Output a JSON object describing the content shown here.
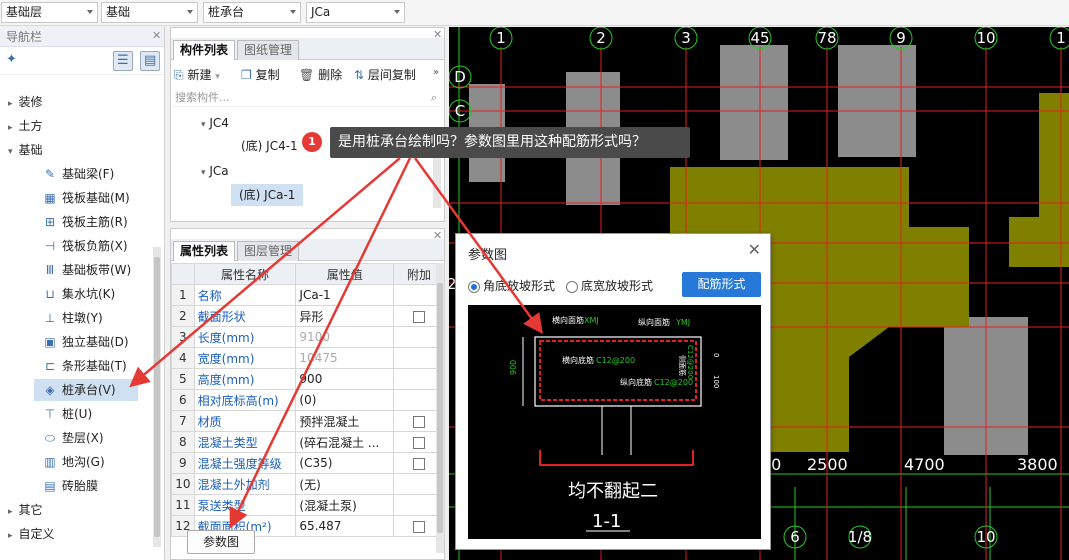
{
  "topbar": {
    "floor": "基础层",
    "category": "基础",
    "type": "桩承台",
    "instance": "JCa"
  },
  "nav": {
    "title": "导航栏",
    "groups": [
      {
        "label": "装修",
        "expanded": false
      },
      {
        "label": "土方",
        "expanded": false
      },
      {
        "label": "基础",
        "expanded": true
      }
    ],
    "items": [
      {
        "label": "基础梁(F)",
        "icon": "beam-icon",
        "glyph": "✎"
      },
      {
        "label": "筏板基础(M)",
        "icon": "grid-icon",
        "glyph": "▦"
      },
      {
        "label": "筏板主筋(R)",
        "icon": "rebar-grid-icon",
        "glyph": "⊞"
      },
      {
        "label": "筏板负筋(X)",
        "icon": "neg-rebar-icon",
        "glyph": "⊣"
      },
      {
        "label": "基础板带(W)",
        "icon": "strip-icon",
        "glyph": "Ⅲ"
      },
      {
        "label": "集水坑(K)",
        "icon": "pit-icon",
        "glyph": "⊔"
      },
      {
        "label": "柱墩(Y)",
        "icon": "pier-icon",
        "glyph": "⊥"
      },
      {
        "label": "独立基础(D)",
        "icon": "isolated-footing-icon",
        "glyph": "▣"
      },
      {
        "label": "条形基础(T)",
        "icon": "strip-footing-icon",
        "glyph": "⊏"
      },
      {
        "label": "桩承台(V)",
        "icon": "pile-cap-icon",
        "glyph": "◈"
      },
      {
        "label": "桩(U)",
        "icon": "pile-icon",
        "glyph": "⊤"
      },
      {
        "label": "垫层(X)",
        "icon": "cushion-icon",
        "glyph": "⬭"
      },
      {
        "label": "地沟(G)",
        "icon": "trench-icon",
        "glyph": "▥"
      },
      {
        "label": "砖胎膜",
        "icon": "brick-icon",
        "glyph": "▤"
      }
    ],
    "groups_after": [
      {
        "label": "其它"
      },
      {
        "label": "自定义"
      }
    ]
  },
  "component_panel": {
    "tabs": [
      "构件列表",
      "图纸管理"
    ],
    "toolbar": {
      "new": "新建",
      "copy": "复制",
      "delete": "删除",
      "floor_copy": "层间复制"
    },
    "search_placeholder": "搜索构件...",
    "tree": [
      {
        "label": "JC4",
        "children": [
          "(底) JC4-1"
        ]
      },
      {
        "label": "JCa",
        "children": [
          "(底) JCa-1"
        ]
      }
    ]
  },
  "property_panel": {
    "tabs": [
      "属性列表",
      "图层管理"
    ],
    "headers": [
      "属性名称",
      "属性值",
      "附加"
    ],
    "rows": [
      {
        "n": "1",
        "name": "名称",
        "value": "JCa-1",
        "check": false
      },
      {
        "n": "2",
        "name": "截面形状",
        "value": "异形",
        "check": true
      },
      {
        "n": "3",
        "name": "长度(mm)",
        "value": "9100",
        "check": false
      },
      {
        "n": "4",
        "name": "宽度(mm)",
        "value": "10475",
        "check": false
      },
      {
        "n": "5",
        "name": "高度(mm)",
        "value": "900",
        "check": false
      },
      {
        "n": "6",
        "name": "相对底标高(m)",
        "value": "(0)",
        "check": false
      },
      {
        "n": "7",
        "name": "材质",
        "value": "预拌混凝土",
        "check": true
      },
      {
        "n": "8",
        "name": "混凝土类型",
        "value": "(碎石混凝土 ...",
        "check": true
      },
      {
        "n": "9",
        "name": "混凝土强度等级",
        "value": "(C35)",
        "check": true
      },
      {
        "n": "10",
        "name": "混凝土外加剂",
        "value": "(无)",
        "check": false
      },
      {
        "n": "11",
        "name": "泵送类型",
        "value": "(混凝土泵)",
        "check": false
      },
      {
        "n": "12",
        "name": "截面面积(m²)",
        "value": "65.487",
        "check": true
      }
    ],
    "bottom_button": "参数图"
  },
  "tooltip": {
    "badge": "1",
    "text": "是用桩承台绘制吗？参数图里用这种配筋形式吗？"
  },
  "cad": {
    "top_axis": [
      "1",
      "2",
      "3",
      "45",
      "78",
      "9",
      "10",
      "1"
    ],
    "left_axis": [
      "D",
      "C"
    ],
    "left_label": "2",
    "dims": [
      "00",
      "2500",
      "4700",
      "3800"
    ],
    "bottom_axis": [
      "6",
      "1/8",
      "10"
    ]
  },
  "dialog": {
    "title": "参数图",
    "radio1": "角底放坡形式",
    "radio2": "底宽放坡形式",
    "button": "配筋形式",
    "drawing": {
      "h_top": "横向面筋",
      "h_top_v": "XMJ",
      "v_top": "纵向面筋",
      "v_top_v": "YMJ",
      "h_bottom": "横向底筋",
      "h_bottom_v": "C12@200",
      "v_bottom": "纵向底筋",
      "v_bottom_v": "C12@200",
      "side": "侧面筋",
      "side_v": "C12@200",
      "height": "900",
      "d1": "0",
      "d2": "100",
      "caption": "均不翻起二",
      "section": "1-1"
    }
  },
  "colors": {
    "accent": "#2679d9",
    "arrow": "#e53935",
    "cad_bg": "#000000",
    "cad_grid": "#e02020",
    "cad_green": "#28c828",
    "cad_yellow": "#808000"
  }
}
